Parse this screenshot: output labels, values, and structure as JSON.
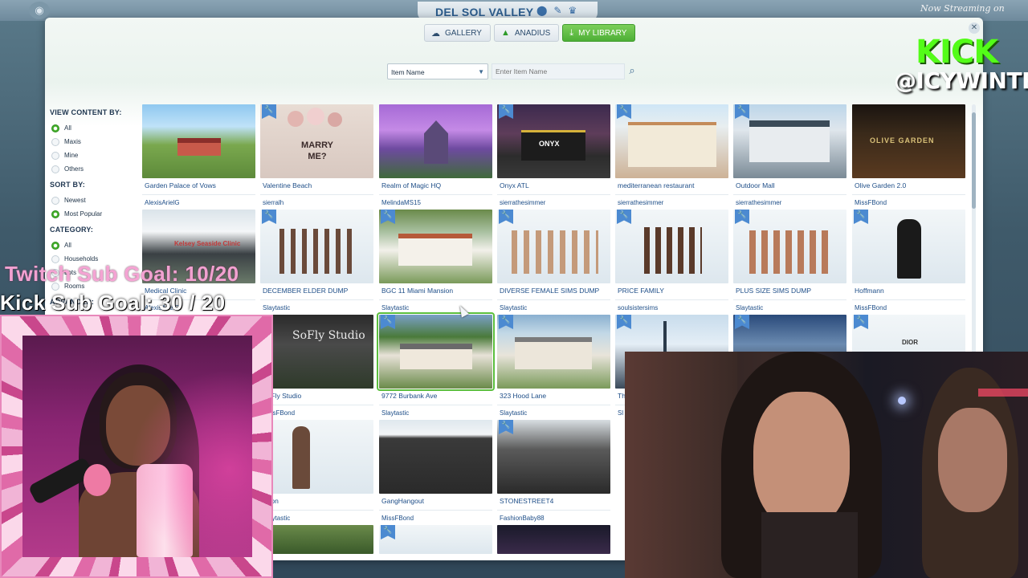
{
  "world": {
    "title": "DEL SOL VALLEY"
  },
  "tabs": [
    {
      "label": "GALLERY",
      "icon": "cloud-icon"
    },
    {
      "label": "ANADIUS",
      "icon": "sims-plumbob-icon"
    },
    {
      "label": "MY LIBRARY",
      "icon": "download-icon"
    }
  ],
  "filter": {
    "selected": "Item Name"
  },
  "search": {
    "placeholder": "Enter Item Name"
  },
  "sidebar": {
    "view_heading": "VIEW CONTENT BY:",
    "view_options": [
      "All",
      "Maxis",
      "Mine",
      "Others"
    ],
    "sort_heading": "SORT BY:",
    "sort_options": [
      "Newest",
      "Most Popular"
    ],
    "category_heading": "CATEGORY:",
    "category_options": [
      "All",
      "Households",
      "Lots",
      "Rooms"
    ],
    "advanced_heading": "ADVANCED:"
  },
  "cards": [
    {
      "name": "Garden Palace of Vows",
      "author": "AlexisArielG"
    },
    {
      "name": "Valentine Beach",
      "author": "sierralh"
    },
    {
      "name": "Realm of Magic HQ",
      "author": "MelindaMS15"
    },
    {
      "name": "Onyx ATL",
      "author": "sierrathesimmer"
    },
    {
      "name": "mediterranean restaurant",
      "author": "sierrathesimmer"
    },
    {
      "name": "Outdoor Mall",
      "author": "sierrathesimmer"
    },
    {
      "name": "Olive Garden 2.0",
      "author": "MissFBond"
    },
    {
      "name": "Medical Clinic",
      "author": "AlexisArielG"
    },
    {
      "name": "DECEMBER ELDER DUMP",
      "author": "Slaytastic"
    },
    {
      "name": "BGC 11 Miami Mansion",
      "author": "Slaytastic"
    },
    {
      "name": "DIVERSE FEMALE SIMS DUMP",
      "author": "Slaytastic"
    },
    {
      "name": "PRICE FAMILY",
      "author": "soulsistersims"
    },
    {
      "name": "PLUS SIZE SIMS DUMP",
      "author": "Slaytastic"
    },
    {
      "name": "Hoffmann",
      "author": "MissFBond"
    },
    {
      "name": "SoFly Studio",
      "author": "MissFBond"
    },
    {
      "name": "9772 Burbank Ave",
      "author": "Slaytastic"
    },
    {
      "name": "323 Hood Lane",
      "author": "Slaytastic"
    },
    {
      "name": "Th",
      "author": "Sl"
    },
    {
      "name": "wson",
      "author": "Slaytastic"
    },
    {
      "name": "GangHangout",
      "author": "MissFBond"
    },
    {
      "name": "STONESTREET4",
      "author": "FashionBaby88"
    }
  ],
  "thumb_labels": {
    "marry_me": "MARRY ME?",
    "onyx": "ONYX",
    "olive_garden": "OLIVE GARDEN",
    "clinic": "Kelsey Seaside Clinic",
    "sofly": "SoFly Studio",
    "dior": "DIOR"
  },
  "overlay": {
    "twitch_goal": "Twitch Sub Goal: 10/20",
    "kick_goal": "Kick Sub Goal: 30 / 20",
    "streaming_on": "Now Streaming on",
    "kick_brand": "KICK",
    "handle": "@ICYWINTRR"
  },
  "colors": {
    "active_tab": "#4daf36",
    "link": "#1e4e88",
    "kick_green": "#53fc18"
  }
}
